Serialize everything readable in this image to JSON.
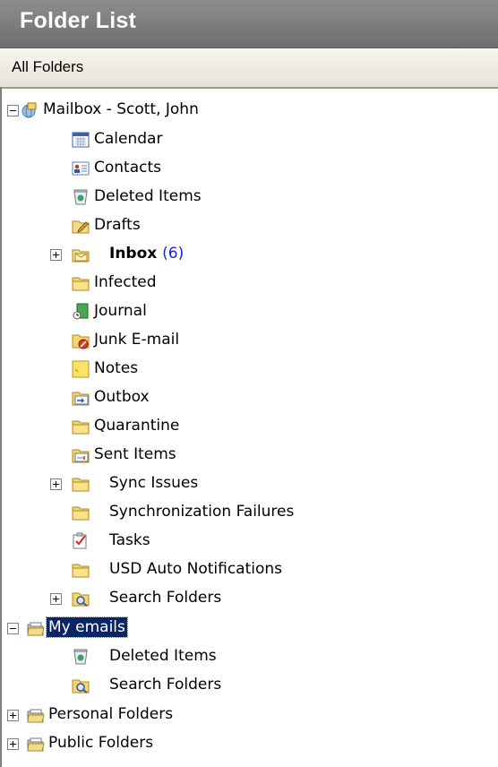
{
  "header": {
    "title": "Folder List"
  },
  "subheader": {
    "label": "All Folders"
  },
  "tree": {
    "mailbox": {
      "label": "Mailbox - Scott, John",
      "children": {
        "calendar": "Calendar",
        "contacts": "Contacts",
        "deleted": "Deleted Items",
        "drafts": "Drafts",
        "inbox": "Inbox",
        "inbox_count": "(6)",
        "infected": "Infected",
        "journal": "Journal",
        "junk": "Junk E-mail",
        "notes": "Notes",
        "outbox": "Outbox",
        "quarantine": "Quarantine",
        "sent": "Sent Items",
        "sync_issues": "Sync Issues",
        "sync_failures": "Synchronization Failures",
        "tasks": "Tasks",
        "usd": "USD Auto Notifications",
        "search": "Search Folders"
      }
    },
    "my_emails": {
      "label": "My emails",
      "children": {
        "deleted": "Deleted Items",
        "search": "Search Folders"
      }
    },
    "personal": {
      "label": "Personal Folders"
    },
    "public": {
      "label": "Public Folders"
    }
  },
  "colors": {
    "unread_count": "#1a23e0",
    "selection": "#0a246a",
    "header": "#7d7d7d"
  }
}
